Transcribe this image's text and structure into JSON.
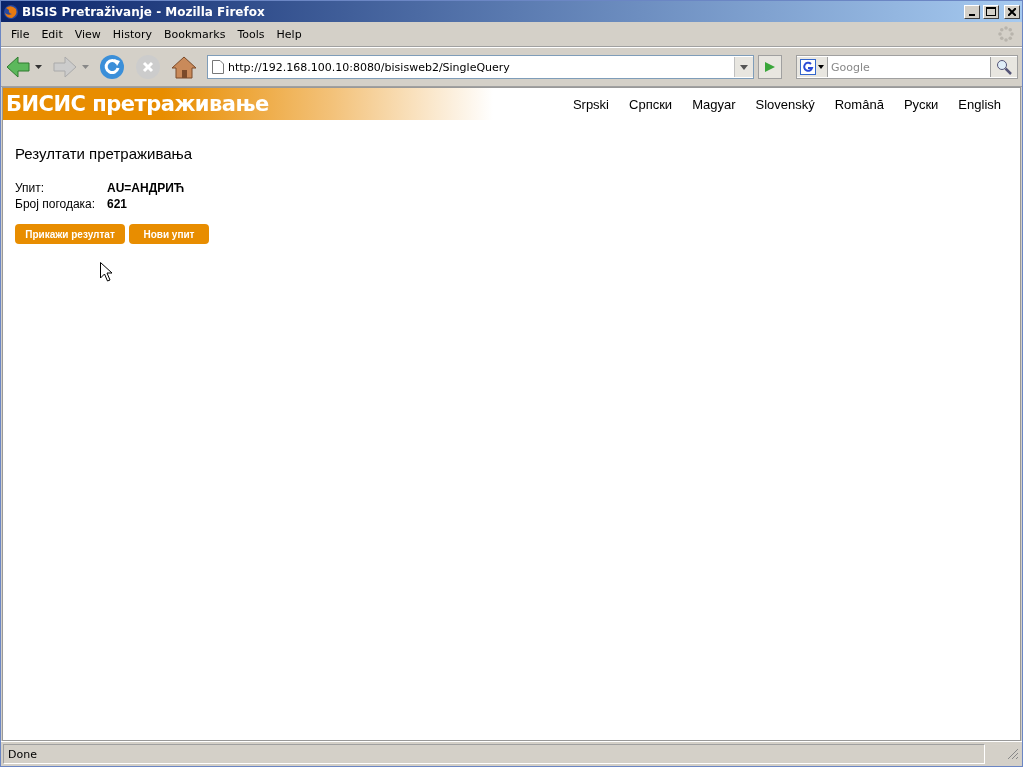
{
  "window": {
    "title": "BISIS Pretraživanje - Mozilla Firefox"
  },
  "menu": [
    "File",
    "Edit",
    "View",
    "History",
    "Bookmarks",
    "Tools",
    "Help"
  ],
  "address_bar": {
    "value": "http://192.168.100.10:8080/bisisweb2/SingleQuery"
  },
  "search": {
    "placeholder": "Google"
  },
  "page": {
    "banner": "БИСИС претраживање",
    "languages": [
      "Srpski",
      "Српски",
      "Magyar",
      "Slovenský",
      "Română",
      "Руски",
      "English"
    ],
    "heading": "Резултати претраживања",
    "fields": [
      {
        "label": "Упит:",
        "value": "AU=АНДРИЋ"
      },
      {
        "label": "Број погодака:",
        "value": "621"
      }
    ],
    "buttons": [
      "Прикажи резултат",
      "Нови упит"
    ]
  },
  "status_bar": "Done"
}
